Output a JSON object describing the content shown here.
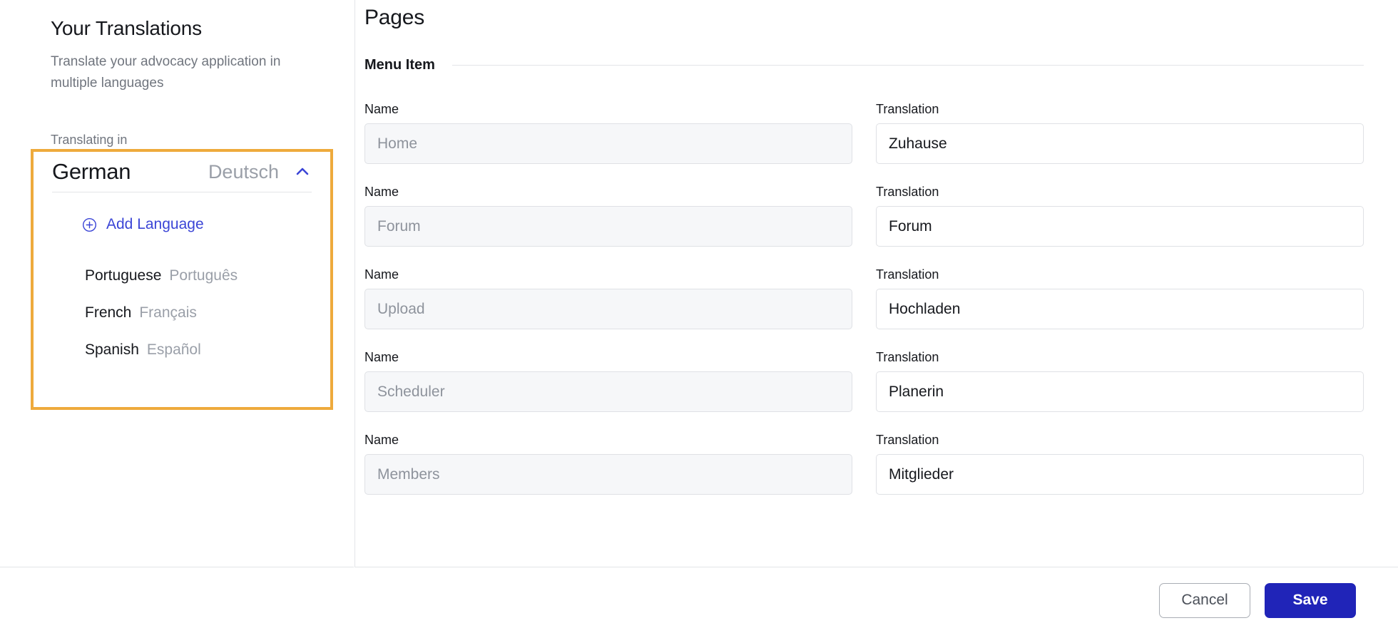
{
  "left": {
    "title": "Your Translations",
    "subtitle": "Translate your advocacy application in multiple languages",
    "translating_in_label": "Translating in",
    "current_language": {
      "name": "German",
      "native": "Deutsch",
      "chevron_icon": "chevron-up-icon"
    },
    "add_language": {
      "label": "Add Language",
      "icon": "plus-circle-icon"
    },
    "languages": [
      {
        "name": "Portuguese",
        "native": "Português"
      },
      {
        "name": "French",
        "native": "Français"
      },
      {
        "name": "Spanish",
        "native": "Español"
      }
    ]
  },
  "right": {
    "section_title": "Pages",
    "subsection_label": "Menu Item",
    "name_label": "Name",
    "translation_label": "Translation",
    "rows": [
      {
        "name": "Home",
        "translation": "Zuhause"
      },
      {
        "name": "Forum",
        "translation": "Forum"
      },
      {
        "name": "Upload",
        "translation": "Hochladen"
      },
      {
        "name": "Scheduler",
        "translation": "Planerin"
      },
      {
        "name": "Members",
        "translation": "Mitglieder"
      }
    ]
  },
  "footer": {
    "cancel_label": "Cancel",
    "save_label": "Save"
  },
  "colors": {
    "highlight_border": "#eeaa3c",
    "primary_blue": "#2024b8",
    "link_blue": "#3b45d6",
    "readonly_bg": "#f6f7f9",
    "muted_text": "#8e939c"
  }
}
